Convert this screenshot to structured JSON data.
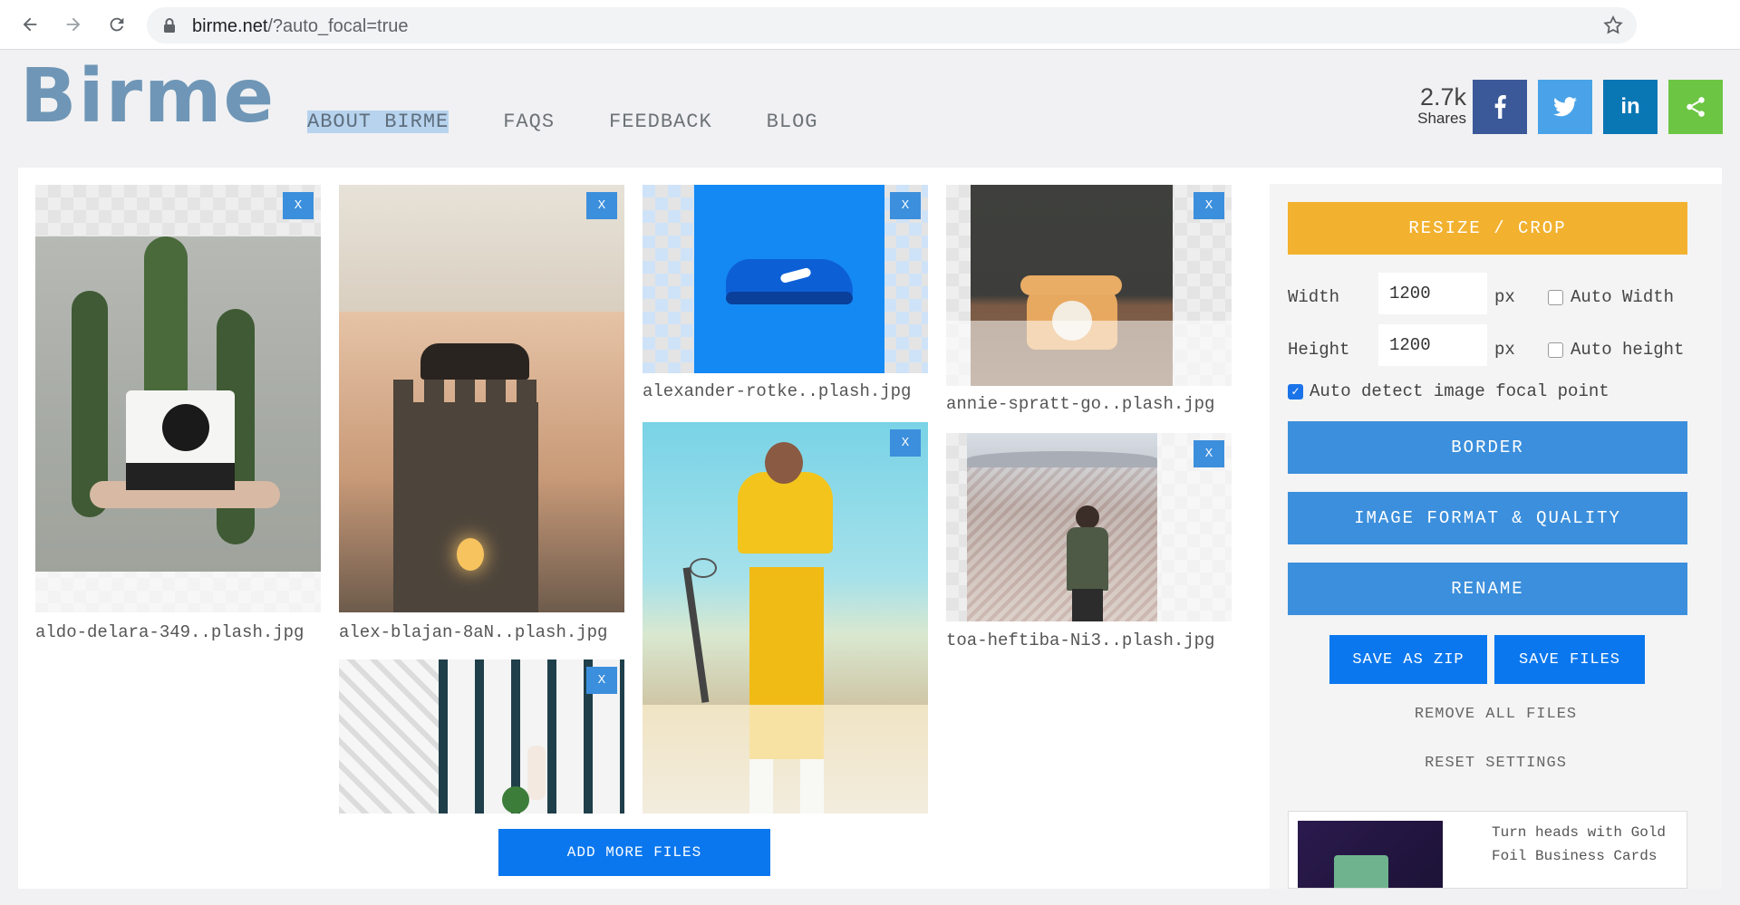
{
  "browser": {
    "url_domain": "birme.net",
    "url_path": "/?auto_focal=true"
  },
  "site": {
    "logo": "Birme",
    "nav": [
      {
        "label": "ABOUT BIRME",
        "active": true
      },
      {
        "label": "FAQS"
      },
      {
        "label": "FEEDBACK"
      },
      {
        "label": "BLOG"
      }
    ],
    "shares_count": "2.7k",
    "shares_label": "Shares",
    "social": [
      {
        "name": "facebook",
        "label": "f",
        "color": "#3b5998"
      },
      {
        "name": "twitter",
        "label": "t",
        "color": "#4aa3e8"
      },
      {
        "name": "linkedin",
        "label": "in",
        "color": "#0a77b5"
      },
      {
        "name": "share",
        "label": "share",
        "color": "#6cc644"
      }
    ]
  },
  "files": [
    {
      "name": "aldo-delara-349..plash.jpg",
      "remove": "X"
    },
    {
      "name": "alex-blajan-8aN..plash.jpg",
      "remove": "X"
    },
    {
      "name": "alexander-rotke..plash.jpg",
      "remove": "X"
    },
    {
      "name": "annie-spratt-go..plash.jpg",
      "remove": "X"
    },
    {
      "name": "",
      "remove": "X"
    },
    {
      "name": "",
      "remove": "X"
    },
    {
      "name": "toa-heftiba-Ni3..plash.jpg",
      "remove": "X"
    }
  ],
  "add_more": "ADD MORE FILES",
  "panel": {
    "resize_crop": "RESIZE / CROP",
    "width_label": "Width",
    "width_value": "1200",
    "width_unit": "px",
    "auto_width": "Auto Width",
    "height_label": "Height",
    "height_value": "1200",
    "height_unit": "px",
    "auto_height": "Auto height",
    "auto_focal": "Auto detect image focal point",
    "border": "BORDER",
    "image_format": "IMAGE FORMAT & QUALITY",
    "rename": "RENAME",
    "save_zip": "SAVE AS ZIP",
    "save_files": "SAVE FILES",
    "remove_all": "REMOVE ALL FILES",
    "reset": "RESET SETTINGS",
    "ad_text": "Turn heads with Gold Foil Business Cards"
  },
  "colors": {
    "accent_blue": "#3c8fdc",
    "resize_yellow": "#f2b12e",
    "save_blue": "#0a77ee"
  }
}
